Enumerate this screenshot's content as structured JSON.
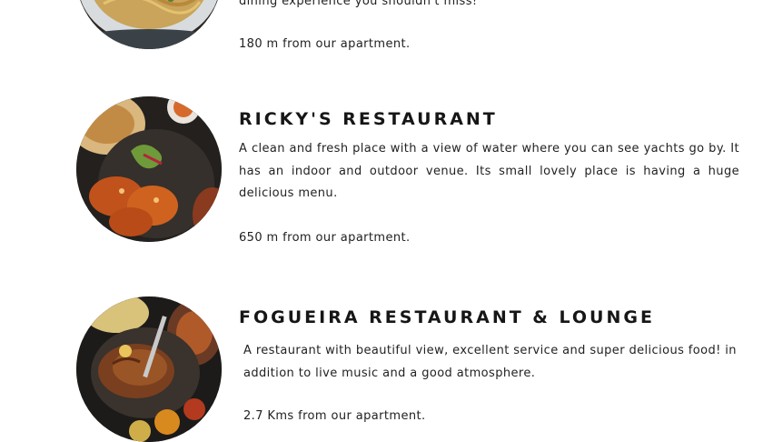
{
  "restaurants": [
    {
      "title": "",
      "description_visible": "dining experience you shouldn't miss!",
      "distance": "180 m from our apartment.",
      "image_icon": "pasta-plate-photo"
    },
    {
      "title": "RICKY'S RESTAURANT",
      "description": "A clean and fresh place with a view of water where you can see yachts go by. It has an indoor and outdoor venue. Its small lovely place is having a huge delicious menu.",
      "distance": "650 m from our apartment.",
      "image_icon": "fried-chicken-plate-photo"
    },
    {
      "title": "FOGUEIRA RESTAURANT & LOUNGE",
      "description": "A restaurant with beautiful view, excellent service and super delicious food! in addition to live music and a good atmosphere.",
      "distance": "2.7 Kms from our apartment.",
      "image_icon": "grilled-chicken-platter-photo"
    }
  ]
}
